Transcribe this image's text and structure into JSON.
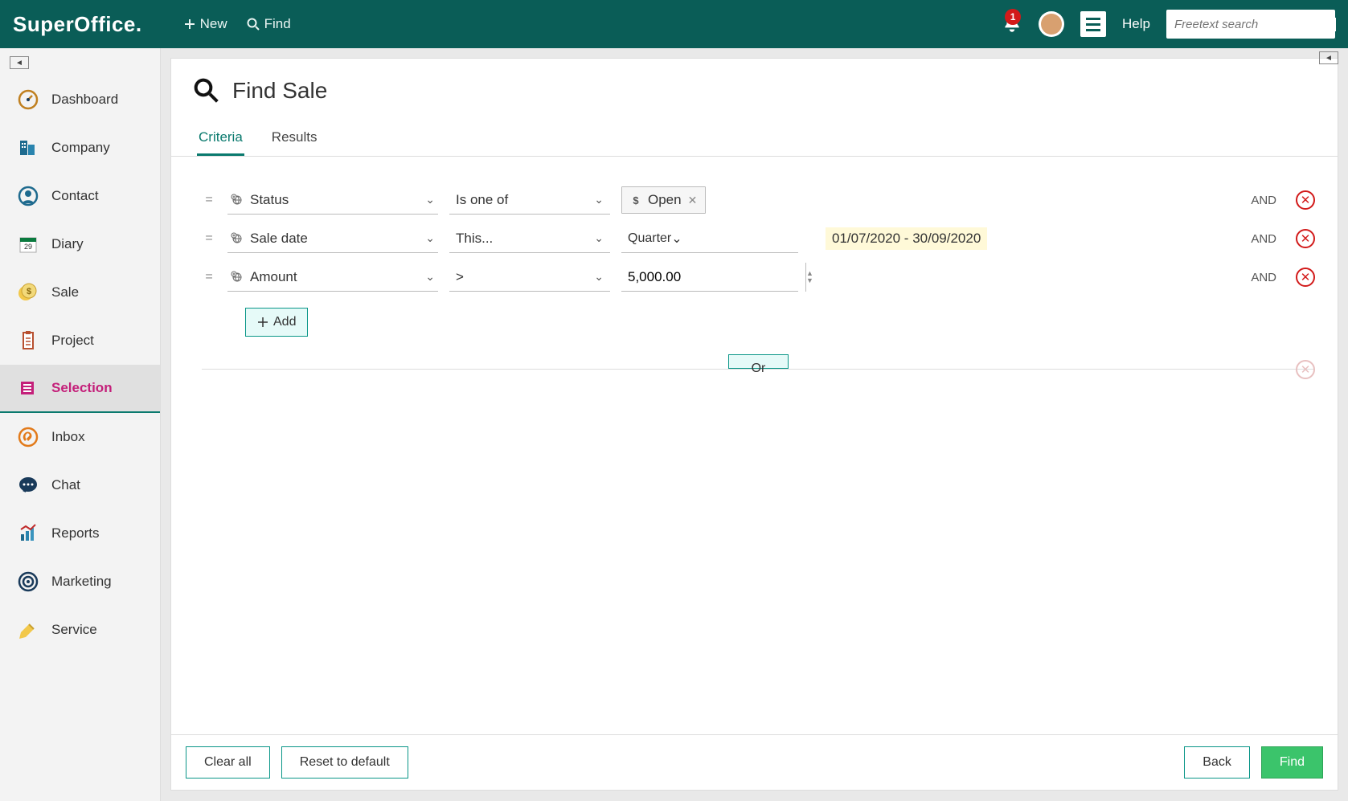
{
  "topbar": {
    "logo": "SuperOffice.",
    "new_label": "New",
    "find_label": "Find",
    "notif_count": "1",
    "help_label": "Help",
    "search_placeholder": "Freetext search"
  },
  "sidebar": {
    "items": [
      {
        "label": "Dashboard"
      },
      {
        "label": "Company"
      },
      {
        "label": "Contact"
      },
      {
        "label": "Diary"
      },
      {
        "label": "Sale"
      },
      {
        "label": "Project"
      },
      {
        "label": "Selection"
      },
      {
        "label": "Inbox"
      },
      {
        "label": "Chat"
      },
      {
        "label": "Reports"
      },
      {
        "label": "Marketing"
      },
      {
        "label": "Service"
      }
    ]
  },
  "page": {
    "title": "Find Sale"
  },
  "tabs": {
    "criteria": "Criteria",
    "results": "Results"
  },
  "criteria": {
    "rows": [
      {
        "field": "Status",
        "operator": "Is one of",
        "chip": "Open",
        "and": "AND"
      },
      {
        "field": "Sale date",
        "operator": "This...",
        "period": "Quarter",
        "date_range": "01/07/2020 - 30/09/2020",
        "and": "AND"
      },
      {
        "field": "Amount",
        "operator": ">",
        "value": "5,000.00",
        "and": "AND"
      }
    ],
    "add_label": "Add",
    "or_label": "Or"
  },
  "footer": {
    "clear_all": "Clear all",
    "reset": "Reset to default",
    "back": "Back",
    "find": "Find"
  }
}
